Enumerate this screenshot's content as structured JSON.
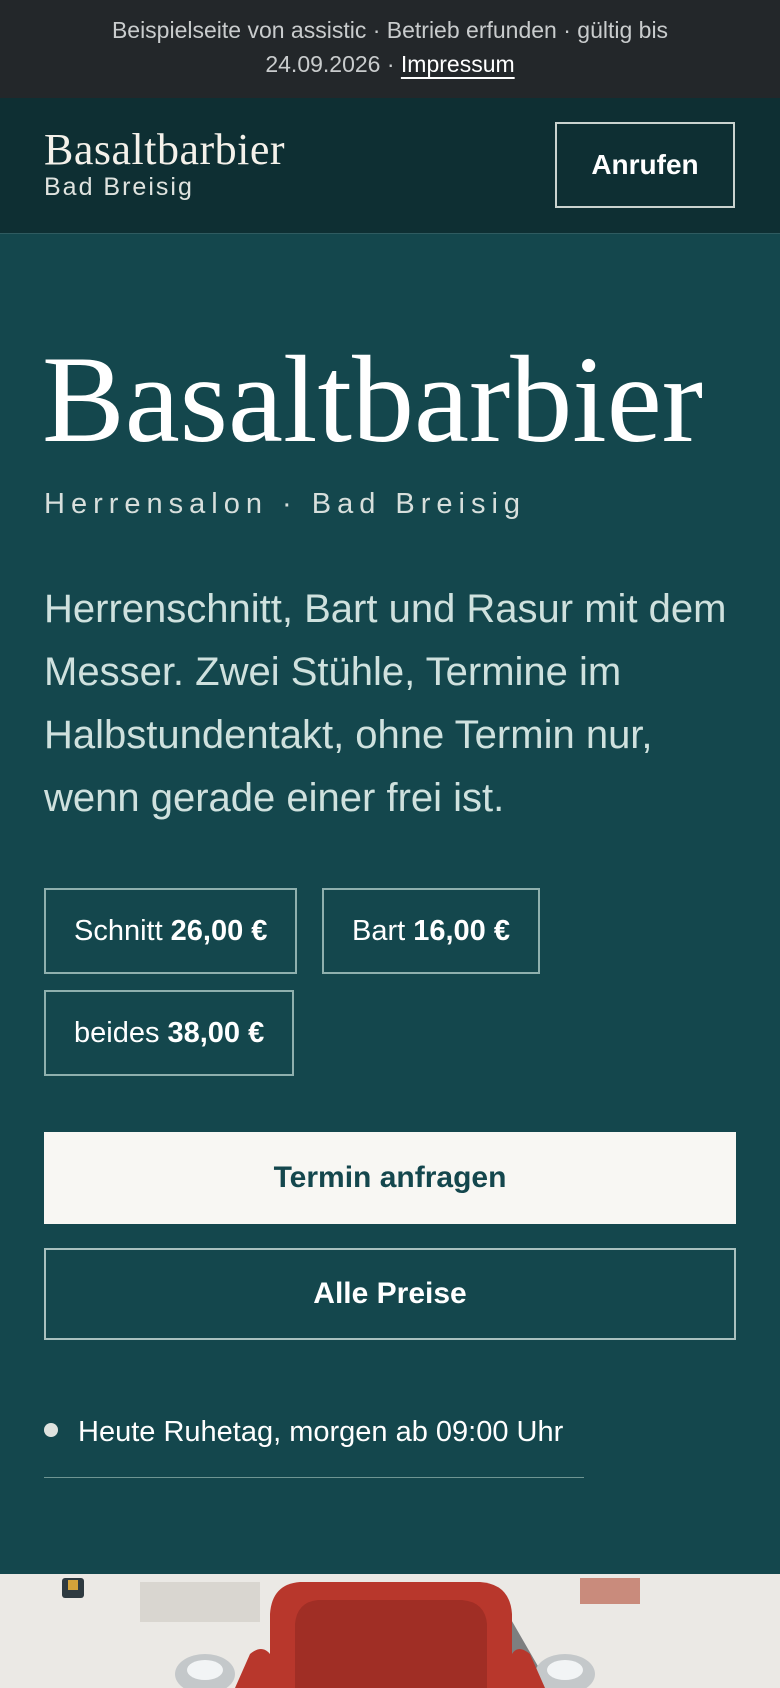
{
  "notice": {
    "line1": "Beispielseite von assistic · Betrieb erfunden · gültig bis",
    "line2_prefix": "24.09.2026 · ",
    "imprint_link": "Impressum"
  },
  "header": {
    "brand_name": "Basaltbarbier",
    "brand_location": "Bad Breisig",
    "call_button": "Anrufen"
  },
  "hero": {
    "title": "Basaltbarbier",
    "subtitle": "Herrensalon · Bad Breisig",
    "description": "Herrenschnitt, Bart und Rasur mit dem Messer. Zwei Stühle, Termine im Halbstundentakt, ohne Termin nur, wenn gerade einer frei ist."
  },
  "prices": [
    {
      "label": "Schnitt",
      "amount": "26,00 €"
    },
    {
      "label": "Bart",
      "amount": "16,00 €"
    },
    {
      "label": "beides",
      "amount": "38,00 €"
    }
  ],
  "actions": {
    "primary": "Termin anfragen",
    "secondary": "Alle Preise"
  },
  "status": {
    "text": "Heute Ruhetag, morgen ab 09:00 Uhr"
  },
  "image": {
    "subject": "barber-chair-photo"
  },
  "colors": {
    "background": "#14474d",
    "header": "#0e2f33",
    "notice_bar": "#23272a",
    "primary_button": "#f8f7f3",
    "chair_red": "#b8372c"
  }
}
